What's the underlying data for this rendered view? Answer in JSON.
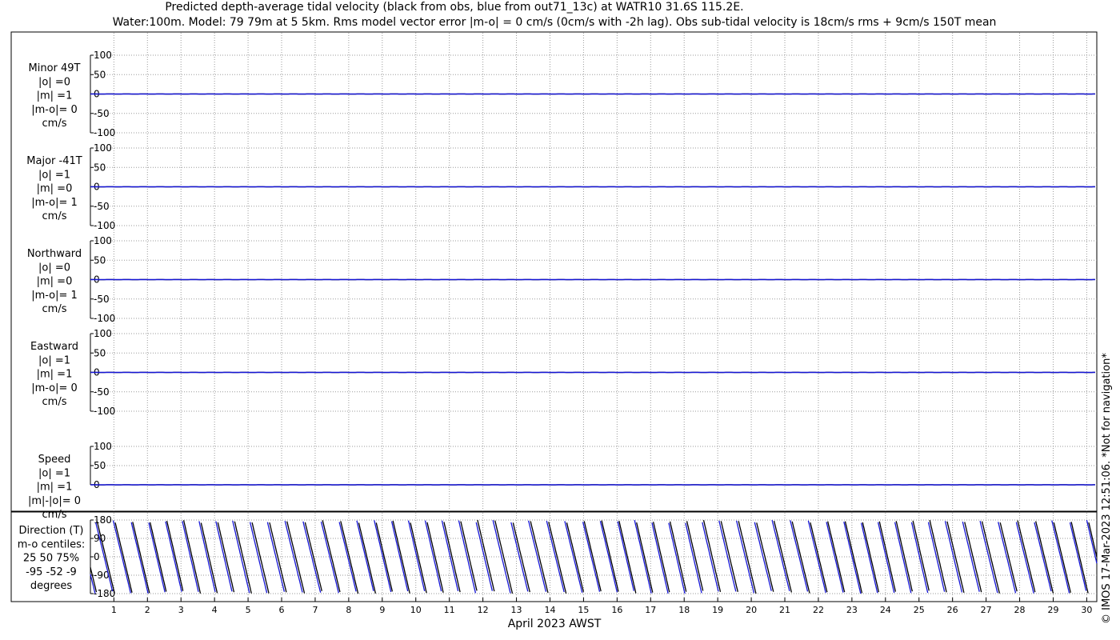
{
  "title_line1": "Predicted depth-average tidal velocity (black from obs, blue from out71_13c) at WATR10 31.6S 115.2E.",
  "title_line2": "Water:100m. Model: 79 79m at 5 5km. Rms model vector error |m-o| = 0 cm/s (0cm/s with -2h lag). Obs sub-tidal velocity is 18cm/s rms + 9cm/s 150T mean",
  "copyright": "© IMOS 17-Mar-2023 12:51:06. *Not for navigation*",
  "colors": {
    "obs": "#000000",
    "model": "#1515d6",
    "grid": "#9a9a9a"
  },
  "chart_data": [
    {
      "type": "line",
      "panel": "minor",
      "label_lines": [
        "Minor 49T",
        "|o| =0",
        "|m| =1",
        "|m-o|= 0",
        "cm/s"
      ],
      "y_ticks": [
        "100",
        "50",
        "0",
        "-50",
        "-100"
      ],
      "ylim": [
        -100,
        100
      ],
      "series": [
        {
          "values_description": "obs",
          "level": 0
        },
        {
          "values_description": "model",
          "level": 0
        }
      ]
    },
    {
      "type": "line",
      "panel": "major",
      "label_lines": [
        "Major -41T",
        "|o| =1",
        "|m| =0",
        "|m-o|= 1",
        "cm/s"
      ],
      "y_ticks": [
        "100",
        "50",
        "0",
        "-50",
        "-100"
      ],
      "ylim": [
        -100,
        100
      ],
      "series": [
        {
          "values_description": "obs",
          "level": 0
        },
        {
          "values_description": "model",
          "level": 0
        }
      ]
    },
    {
      "type": "line",
      "panel": "northward",
      "label_lines": [
        "Northward",
        "|o| =0",
        "|m| =0",
        "|m-o|= 1",
        "cm/s"
      ],
      "y_ticks": [
        "100",
        "50",
        "0",
        "-50",
        "-100"
      ],
      "ylim": [
        -100,
        100
      ],
      "series": [
        {
          "values_description": "obs",
          "level": 0
        },
        {
          "values_description": "model",
          "level": 0
        }
      ]
    },
    {
      "type": "line",
      "panel": "eastward",
      "label_lines": [
        "Eastward",
        "|o| =1",
        "|m| =1",
        "|m-o|= 0",
        "cm/s"
      ],
      "y_ticks": [
        "100",
        "50",
        "0",
        "-50",
        "-100"
      ],
      "ylim": [
        -100,
        100
      ],
      "series": [
        {
          "values_description": "obs",
          "level": 0
        },
        {
          "values_description": "model",
          "level": 0
        }
      ]
    },
    {
      "type": "line",
      "panel": "speed",
      "label_lines": [
        "Speed",
        "|o| =1",
        "|m| =1",
        "|m|-|o|= 0",
        "cm/s"
      ],
      "y_ticks": [
        "100",
        "50",
        "0"
      ],
      "ylim": [
        0,
        100
      ],
      "series": [
        {
          "values_description": "obs",
          "level": 0
        },
        {
          "values_description": "model",
          "level": 0
        }
      ]
    },
    {
      "type": "line",
      "panel": "direction",
      "label_lines": [
        "Direction (T)",
        "m-o centiles:",
        "25  50  75%",
        "-95 -52  -9",
        "degrees"
      ],
      "y_ticks": [
        "180",
        "90",
        "0",
        "-90",
        "-180"
      ],
      "ylim": [
        -180,
        180
      ],
      "xlabel": "April 2023 AWST",
      "x_ticks": [
        "1",
        "2",
        "3",
        "4",
        "5",
        "6",
        "7",
        "8",
        "9",
        "10",
        "11",
        "12",
        "13",
        "14",
        "15",
        "16",
        "17",
        "18",
        "19",
        "20",
        "21",
        "22",
        "23",
        "24",
        "25",
        "26",
        "27",
        "28",
        "29",
        "30"
      ],
      "xlim": [
        0.3,
        30.3
      ],
      "series": [
        {
          "values_description": "obs direction, wraps between -180 and 180 roughly twice per day"
        },
        {
          "values_description": "model direction, wraps between -180 and 180 roughly twice per day"
        }
      ]
    }
  ]
}
